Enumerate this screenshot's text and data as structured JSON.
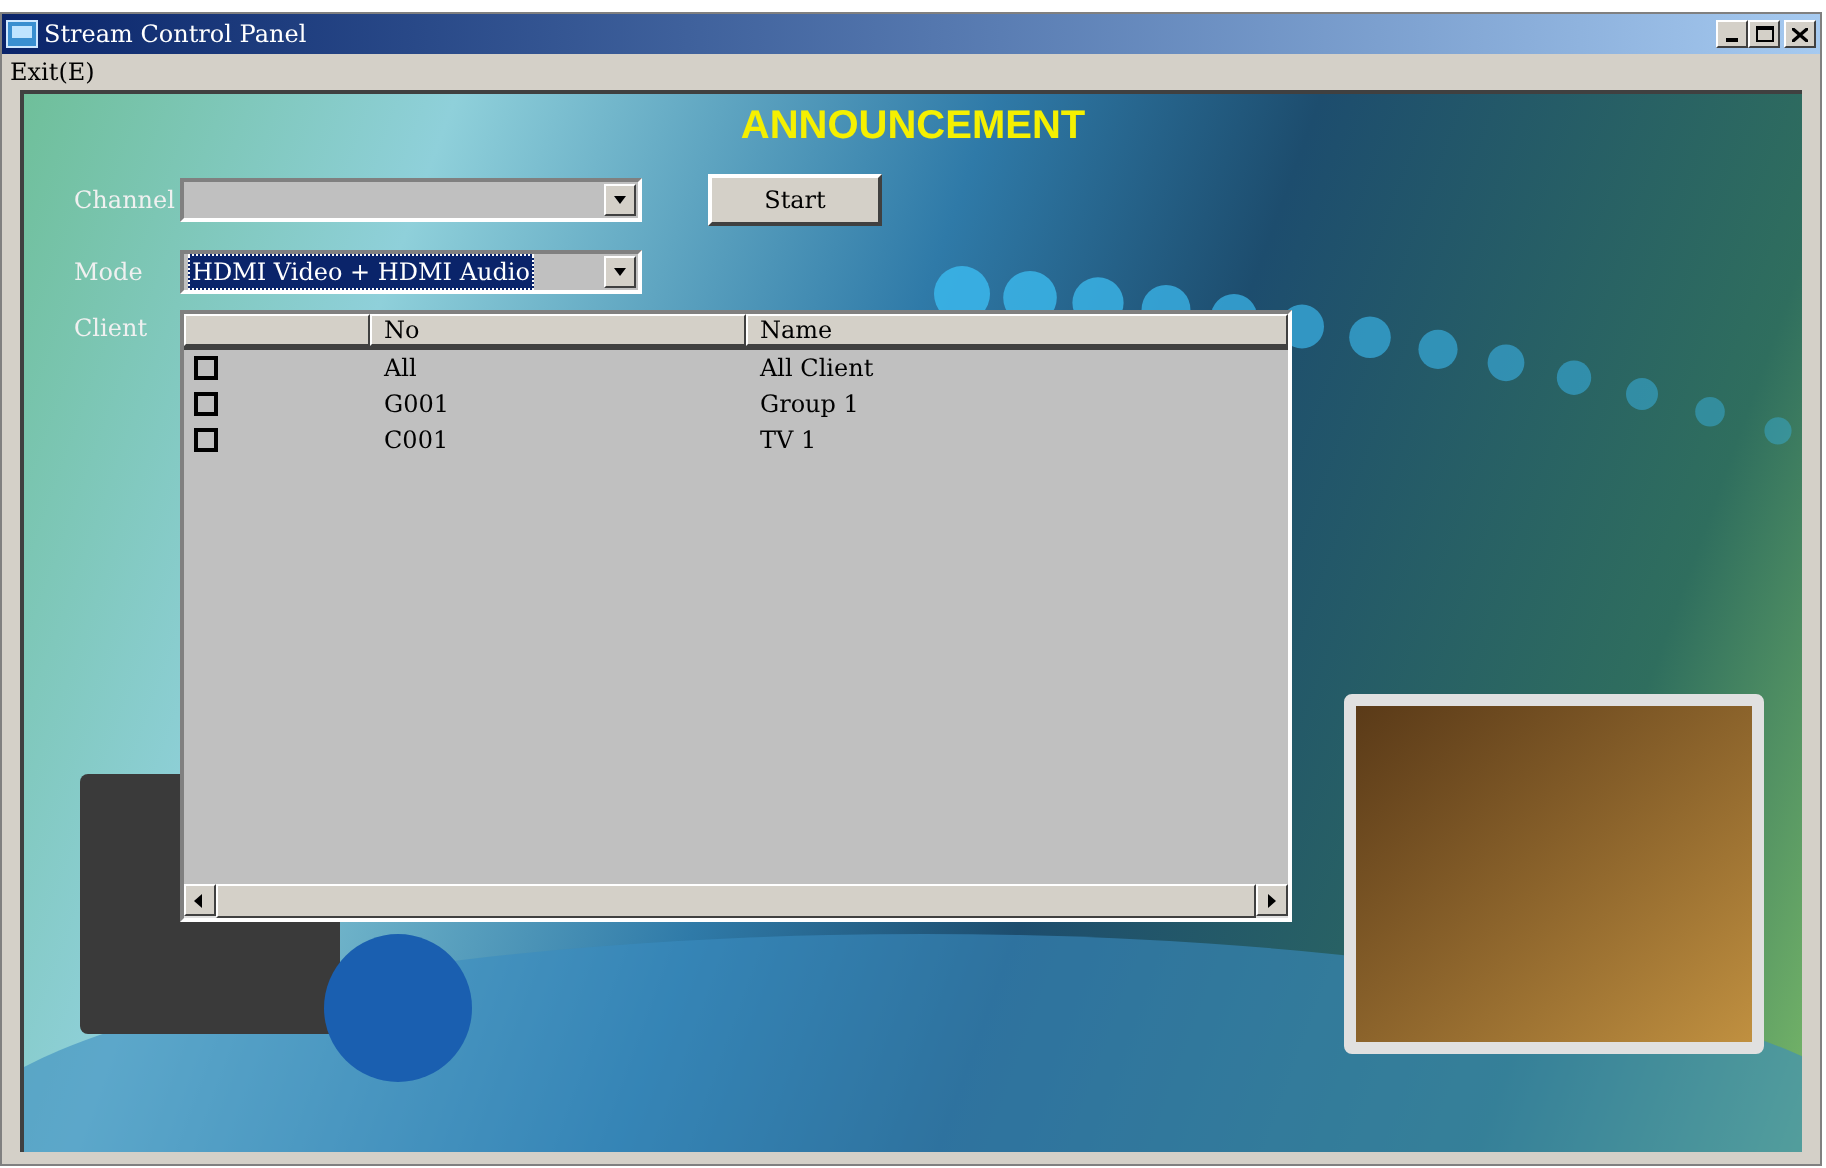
{
  "window": {
    "title": "Stream Control Panel"
  },
  "menu": [
    "Exit(E)"
  ],
  "heading": "ANNOUNCEMENT",
  "form": {
    "channel": {
      "label": "Channel"
    },
    "mode": {
      "label": "Mode",
      "value": "HDMI Video + HDMI Audio"
    },
    "start_button": "Start",
    "client_label": "Client"
  },
  "table": {
    "columns": [
      "No",
      "Name"
    ],
    "rows": [
      {
        "checked": false,
        "no": "All",
        "name": "All Client"
      },
      {
        "checked": false,
        "no": "G001",
        "name": "Group 1"
      },
      {
        "checked": false,
        "no": "C001",
        "name": "TV 1"
      }
    ]
  }
}
